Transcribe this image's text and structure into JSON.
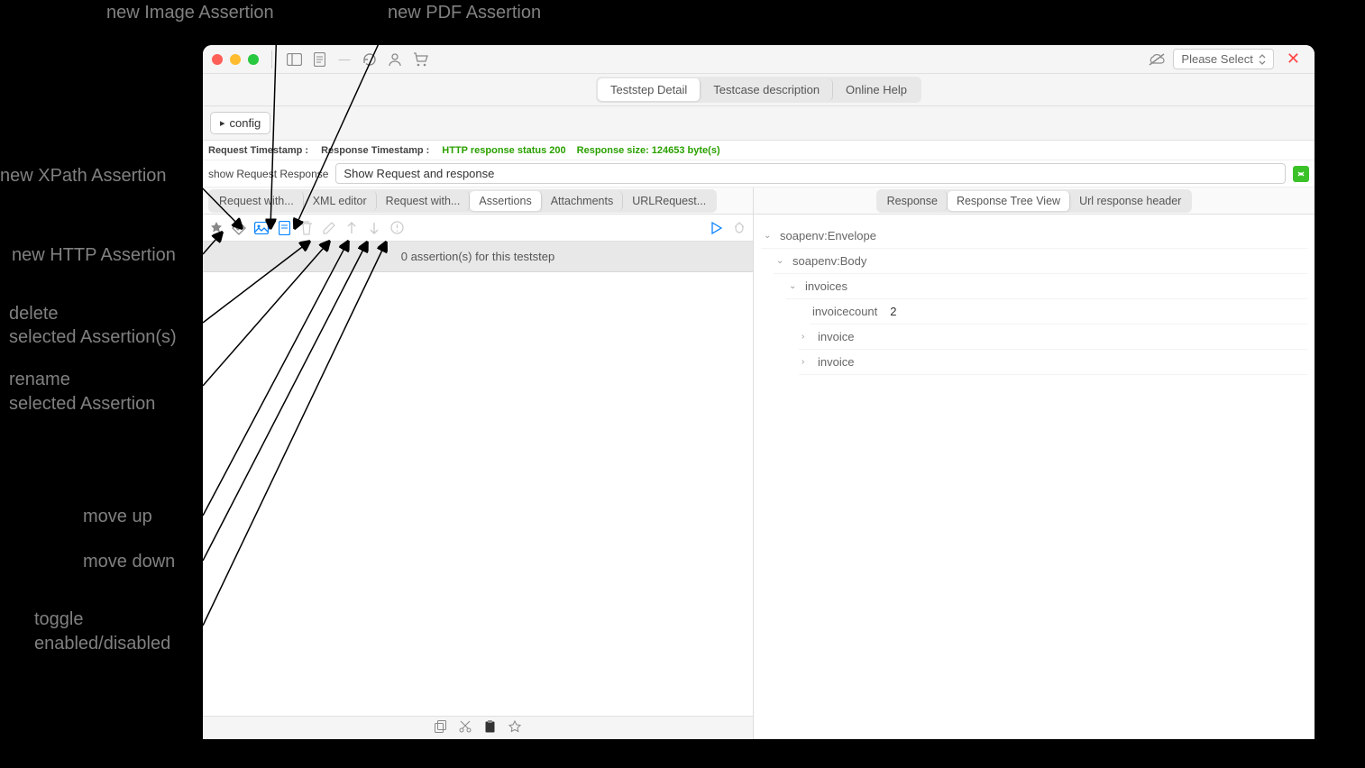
{
  "callouts": {
    "image_assertion": "new Image Assertion",
    "pdf_assertion": "new PDF Assertion",
    "xpath_assertion": "new XPath Assertion",
    "http_assertion": "new HTTP Assertion",
    "delete_1": "delete",
    "delete_2": "selected Assertion(s)",
    "rename_1": "rename",
    "rename_2": "selected Assertion",
    "move_up": "move up",
    "move_down": "move down",
    "toggle_1": "toggle",
    "toggle_2": "enabled/disabled"
  },
  "titlebar": {
    "select_label": "Please Select"
  },
  "top_tabs": {
    "teststep": "Teststep Detail",
    "testcase": "Testcase description",
    "online_help": "Online Help"
  },
  "config_btn": "config",
  "status": {
    "req_ts": "Request Timestamp :",
    "resp_ts": "Response Timestamp :",
    "http": "HTTP response status 200",
    "size": "Response size: 124653  byte(s)"
  },
  "showreq": {
    "label": "show Request Response",
    "select": "Show Request and response"
  },
  "left_tabs": {
    "req1": "Request with...",
    "xml": "XML editor",
    "req2": "Request with...",
    "assertions": "Assertions",
    "attachments": "Attachments",
    "url": "URLRequest..."
  },
  "right_tabs": {
    "response": "Response",
    "tree": "Response Tree View",
    "header": "Url response header"
  },
  "assertion_count": "0 assertion(s) for this teststep",
  "tree": {
    "envelope": "soapenv:Envelope",
    "body": "soapenv:Body",
    "invoices": "invoices",
    "invoicecount_label": "invoicecount",
    "invoicecount_val": "2",
    "invoice": "invoice"
  }
}
